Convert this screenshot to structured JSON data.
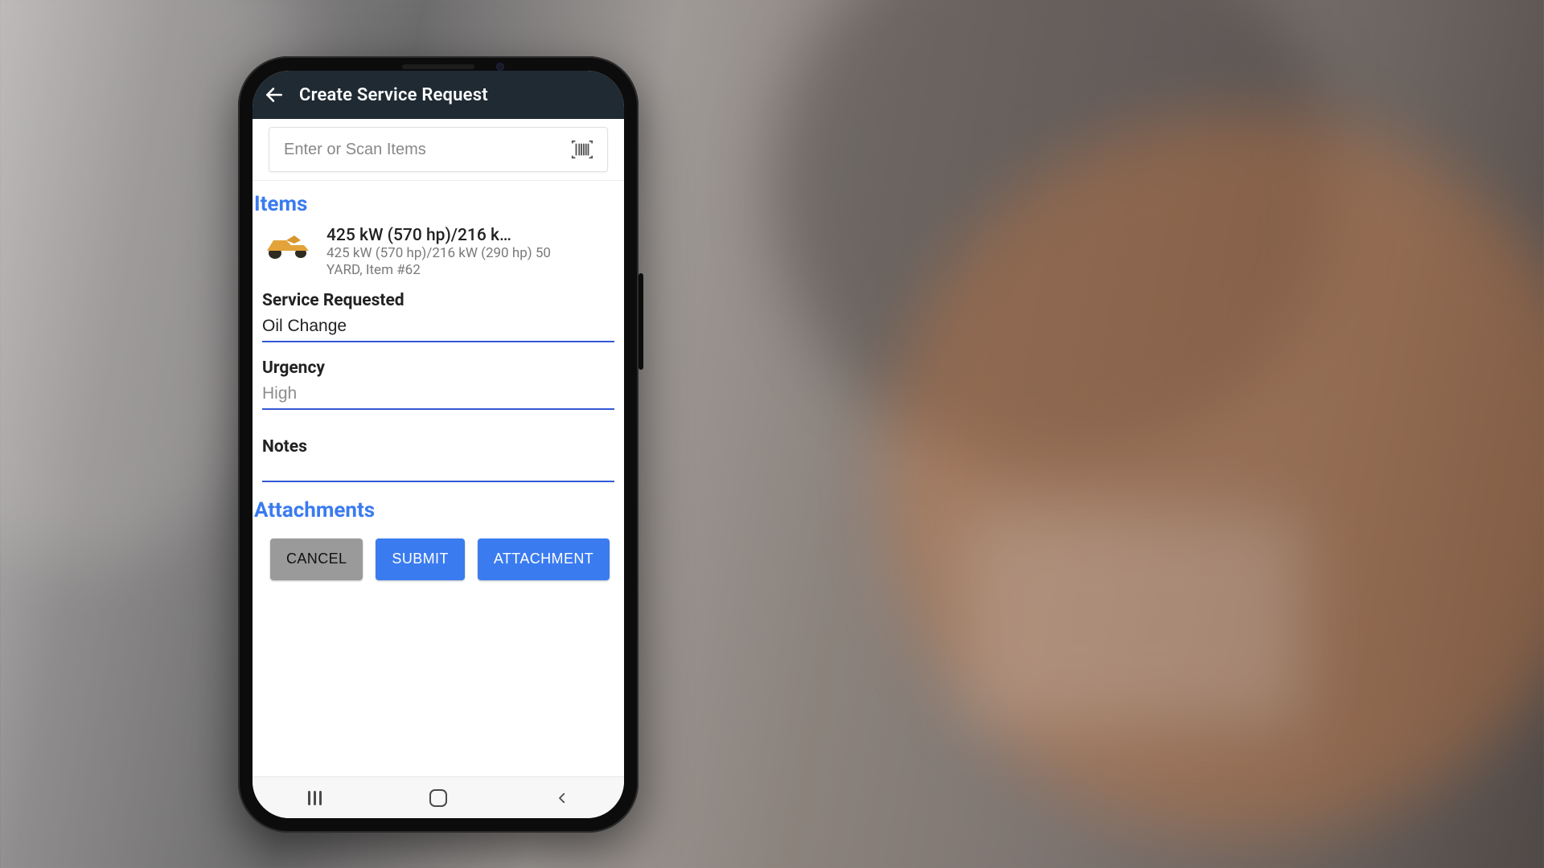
{
  "header": {
    "title": "Create Service Request"
  },
  "search": {
    "placeholder": "Enter or Scan Items"
  },
  "sections": {
    "items_title": "Items",
    "attachments_title": "Attachments"
  },
  "item": {
    "title": "425 kW (570 hp)/216 k…",
    "subtitle": "425 kW (570 hp)/216 kW (290 hp) 50 YARD, Item #62"
  },
  "fields": {
    "service_label": "Service Requested",
    "service_value": "Oil Change",
    "urgency_label": "Urgency",
    "urgency_value": "High",
    "notes_label": "Notes",
    "notes_value": ""
  },
  "buttons": {
    "cancel": "CANCEL",
    "submit": "SUBMIT",
    "attachment": "ATTACHMENT"
  }
}
